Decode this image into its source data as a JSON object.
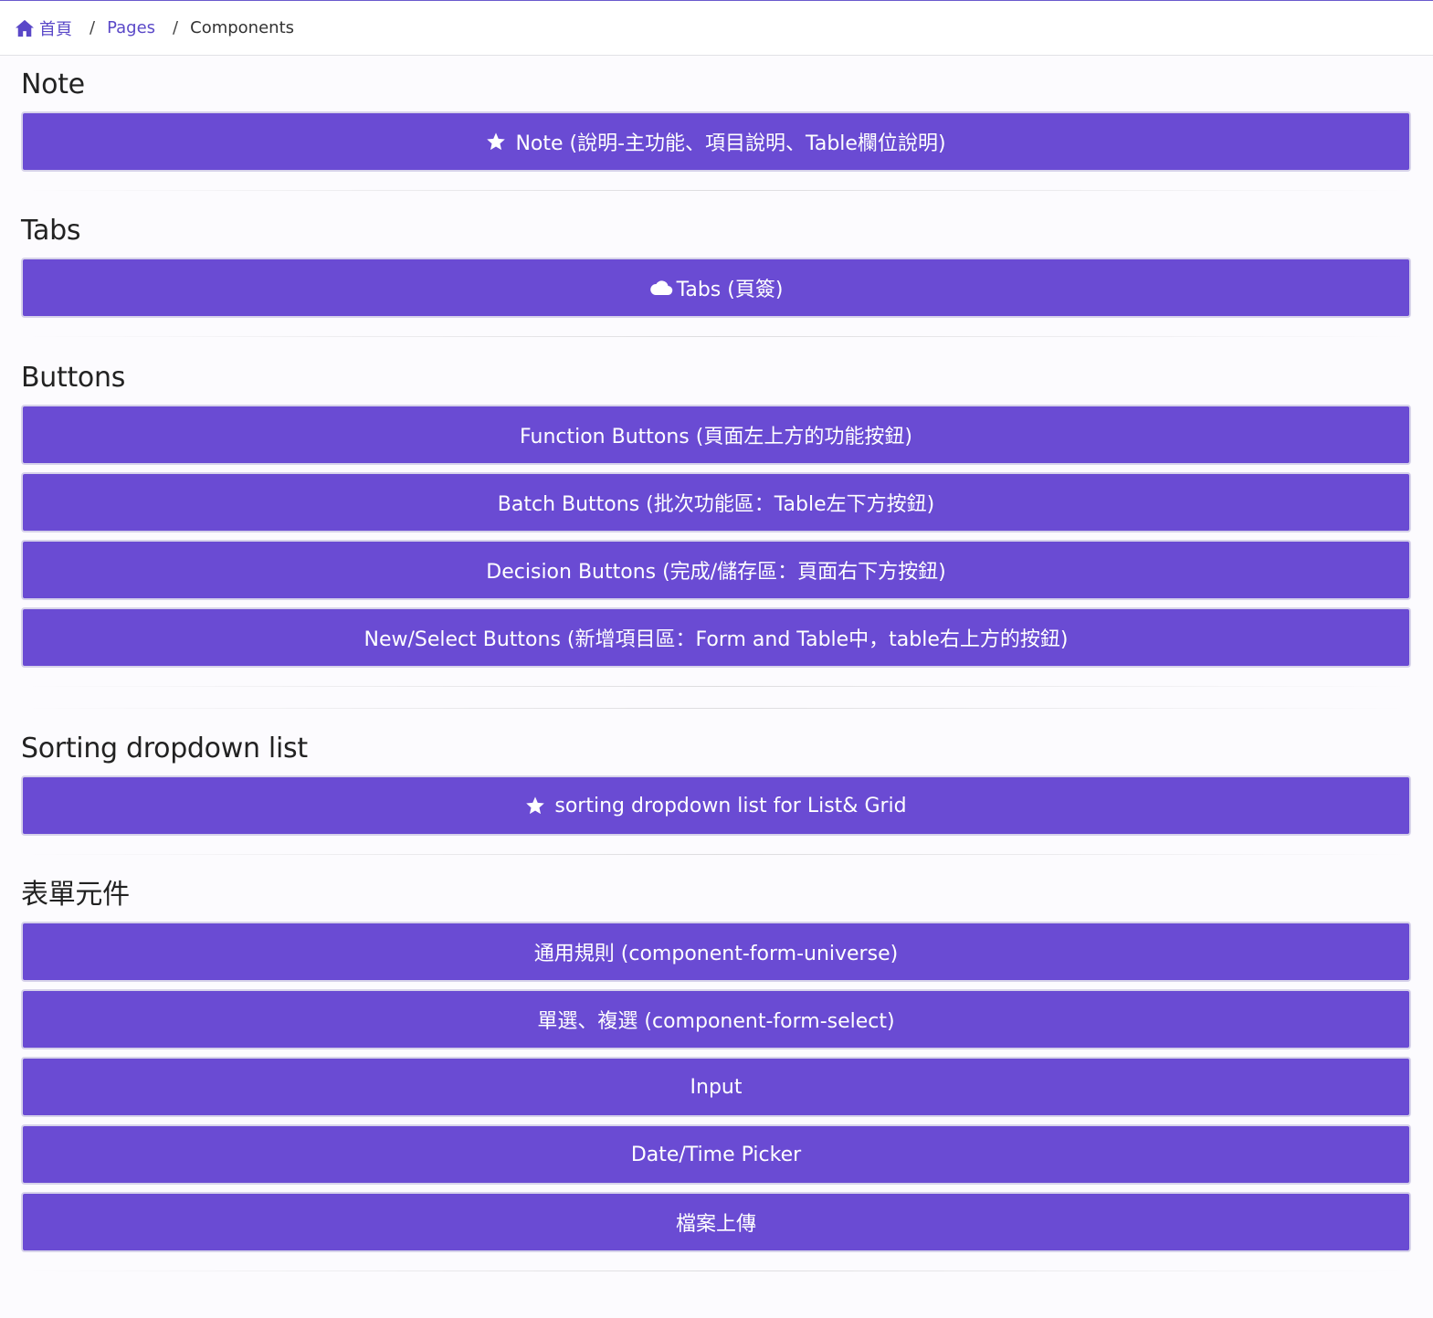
{
  "breadcrumb": {
    "home_label": "首頁",
    "separator": "/",
    "pages_label": "Pages",
    "current_label": "Components"
  },
  "sections": {
    "note": {
      "title": "Note",
      "buttons": [
        "Note (說明-主功能、項目說明、Table欄位說明)"
      ]
    },
    "tabs": {
      "title": "Tabs",
      "buttons": [
        "Tabs (頁簽)"
      ]
    },
    "buttons": {
      "title": "Buttons",
      "buttons": [
        "Function Buttons (頁面左上方的功能按鈕)",
        "Batch Buttons (批次功能區：Table左下方按鈕)",
        "Decision Buttons (完成/儲存區：頁面右下方按鈕)",
        "New/Select Buttons (新增項目區：Form and Table中，table右上方的按鈕)"
      ]
    },
    "sorting": {
      "title": "Sorting dropdown list",
      "buttons": [
        "sorting dropdown list for List& Grid"
      ]
    },
    "form": {
      "title": "表單元件",
      "buttons": [
        "通用規則 (component-form-universe)",
        "單選、複選 (component-form-select)",
        "Input",
        "Date/Time Picker",
        "檔案上傳"
      ]
    }
  },
  "colors": {
    "accent": "#6a4bd3",
    "link": "#5a48c8"
  },
  "icons": {
    "home": "home-icon",
    "star": "star-icon",
    "cloud": "cloud-icon"
  }
}
